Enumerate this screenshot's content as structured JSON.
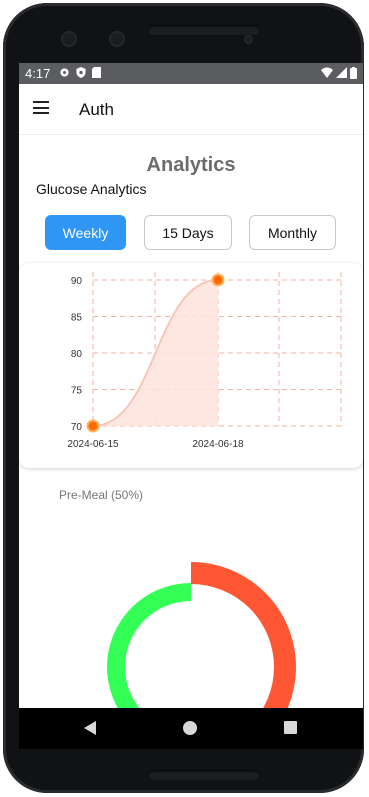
{
  "status_bar": {
    "time": "4:17"
  },
  "app_bar": {
    "title": "Auth"
  },
  "page": {
    "title": "Analytics",
    "subtitle": "Glucose Analytics"
  },
  "tabs": [
    {
      "label": "Weekly",
      "active": true
    },
    {
      "label": "15 Days",
      "active": false
    },
    {
      "label": "Monthly",
      "active": false
    }
  ],
  "chart_data": [
    {
      "type": "area",
      "x": [
        "2024-06-15",
        "2024-06-18"
      ],
      "y": [
        70,
        90
      ],
      "xticks": [
        "2024-06-15",
        "2024-06-18"
      ],
      "yticks": [
        70,
        75,
        80,
        85,
        90
      ],
      "ylim": [
        70,
        90
      ],
      "grid": true,
      "colors": {
        "line": "#f9c6b6",
        "fill": "#fde3da",
        "point": "#ff6a00",
        "grid": "#f3b2a1"
      }
    },
    {
      "type": "pie",
      "title": "Pre-Meal (50%)",
      "slices": [
        {
          "value": 50,
          "color": "#ff5733"
        },
        {
          "value": 50,
          "color": "#33ff57"
        }
      ],
      "donut": true
    }
  ]
}
